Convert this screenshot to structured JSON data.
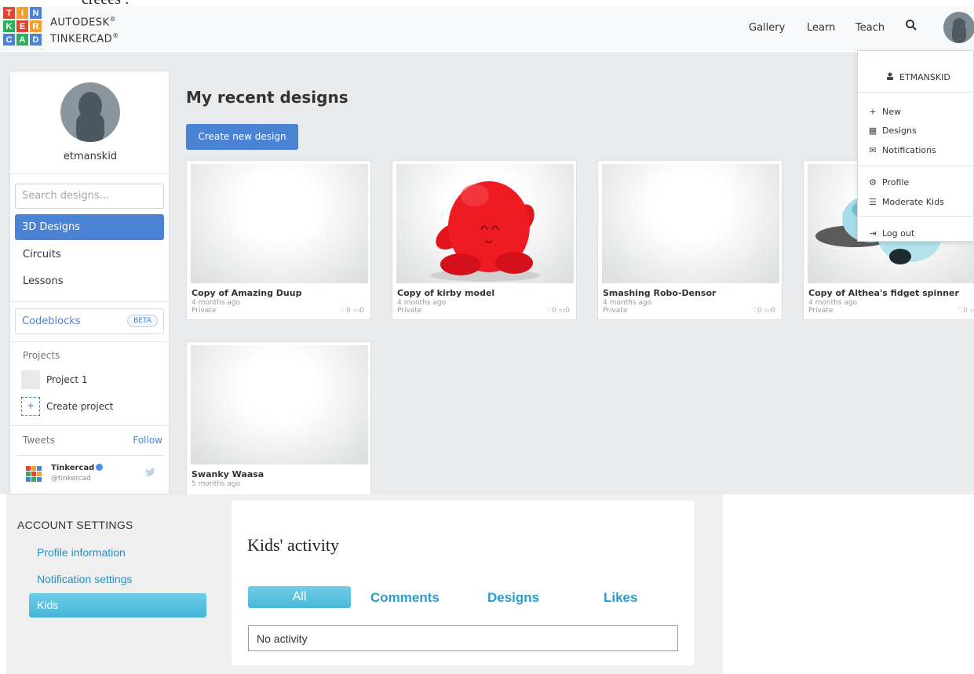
{
  "stray_text": "creees :",
  "brand": {
    "logo_letters": [
      "T",
      "I",
      "N",
      "K",
      "E",
      "R",
      "C",
      "A",
      "D"
    ],
    "logo_colors": [
      "#e2442f",
      "#f2a02b",
      "#4a83d3",
      "#2fae5b",
      "#e2442f",
      "#f2a02b",
      "#4a83d3",
      "#2fae5b",
      "#4a83d3"
    ],
    "line1": "AUTODESK",
    "line2": "TINKERCAD",
    "reg": "®"
  },
  "topnav": {
    "gallery": "Gallery",
    "learn": "Learn",
    "teach": "Teach"
  },
  "sidebar": {
    "username": "etmanskid",
    "search_placeholder": "Search designs...",
    "items": [
      {
        "label": "3D Designs"
      },
      {
        "label": "Circuits"
      },
      {
        "label": "Lessons"
      }
    ],
    "codeblocks": "Codeblocks",
    "beta": "BETA",
    "projects_label": "Projects",
    "project1": "Project 1",
    "create_project": "Create project",
    "create_icon": "+",
    "tweets_label": "Tweets",
    "follow": "Follow",
    "tweet_name": "Tinkercad",
    "tweet_handle": "@tinkercad"
  },
  "main": {
    "title": "My recent designs",
    "create_button": "Create new design",
    "designs": [
      {
        "title": "Copy of Amazing Duup",
        "when": "4 months ago",
        "privacy": "Private",
        "likes": "0",
        "comments": "0",
        "thumb": "blank"
      },
      {
        "title": "Copy of kirby model",
        "when": "4 months ago",
        "privacy": "Private",
        "likes": "0",
        "comments": "0",
        "thumb": "kirby"
      },
      {
        "title": "Smashing Robo-Densor",
        "when": "4 months ago",
        "privacy": "Private",
        "likes": "0",
        "comments": "0",
        "thumb": "blank"
      },
      {
        "title": "Copy of Althea's fidget spinner",
        "when": "4 months ago",
        "privacy": "Private",
        "likes": "0",
        "comments": "0",
        "thumb": "spinner"
      },
      {
        "title": "Swanky Waasa",
        "when": "5 months ago",
        "privacy": "",
        "likes": "",
        "comments": "",
        "thumb": "blank"
      }
    ]
  },
  "dropdown": {
    "username": "ETMANSKID",
    "items": [
      {
        "label": "New",
        "icon": "plus-icon"
      },
      {
        "label": "Designs",
        "icon": "grid-icon"
      },
      {
        "label": "Notifications",
        "icon": "envelope-icon"
      },
      {
        "label": "Profile",
        "icon": "gear-icon"
      },
      {
        "label": "Moderate Kids",
        "icon": "list-icon"
      },
      {
        "label": "Log out",
        "icon": "logout-icon"
      }
    ]
  },
  "account": {
    "title": "ACCOUNT SETTINGS",
    "profile_information": "Profile information",
    "notification_settings": "Notification settings",
    "kids": "Kids"
  },
  "kids_activity": {
    "title": "Kids' activity",
    "tabs": [
      "All",
      "Comments",
      "Designs",
      "Likes"
    ],
    "empty": "No activity"
  },
  "colors": {
    "accent": "#4a83d3",
    "kids_accent": "#44b5d9",
    "kids_tab_text": "#2a9bd0"
  }
}
